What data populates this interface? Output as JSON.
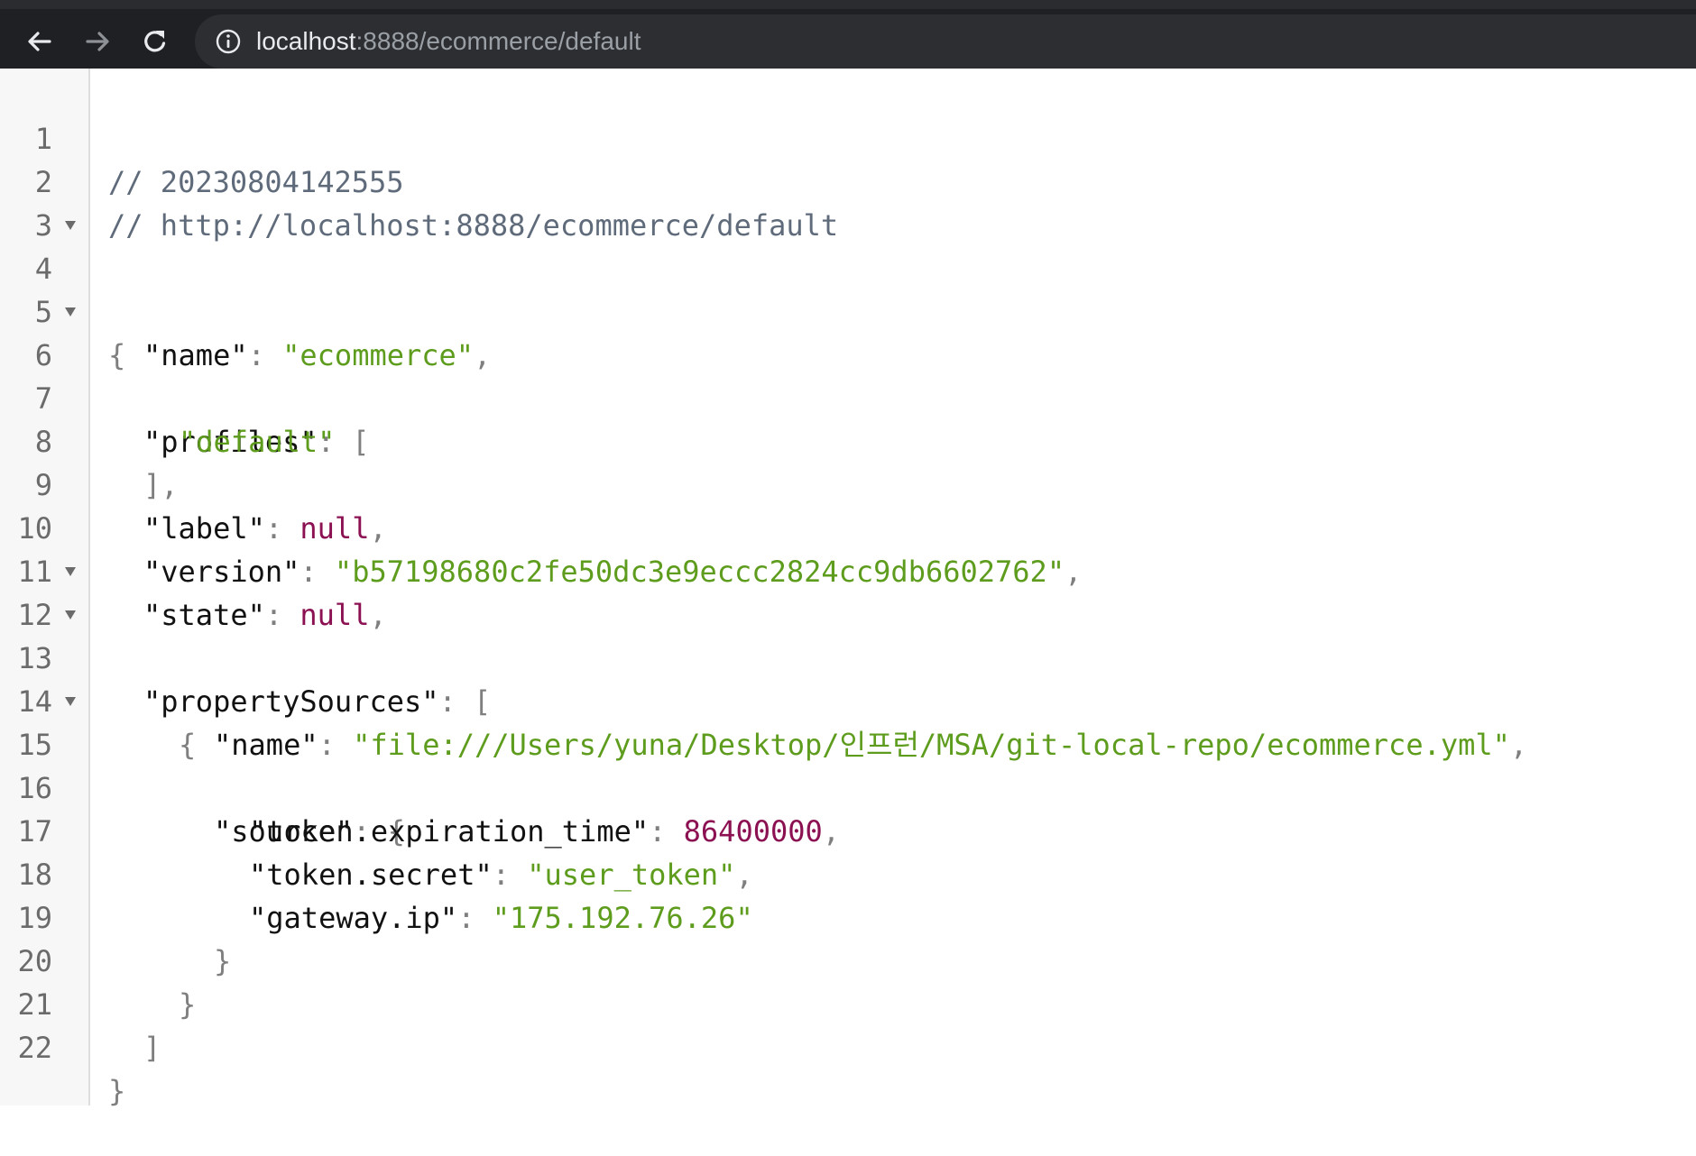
{
  "browser": {
    "url_host": "localhost",
    "url_rest": ":8888/ecommerce/default",
    "back_icon": "back-arrow-icon",
    "forward_icon": "forward-arrow-icon",
    "reload_icon": "reload-icon",
    "info_icon": "info-icon"
  },
  "colors": {
    "toolbar": "#1f2023",
    "address_bar": "#2d2e31",
    "string": "#5e9c1d",
    "null_number": "#8b1152",
    "comment": "#5f6b7a"
  },
  "lines": {
    "l1": {
      "num": "1",
      "comment": "// 20230804142555"
    },
    "l2": {
      "num": "2",
      "comment": "// http://localhost:8888/ecommerce/default"
    },
    "l3": {
      "num": "3"
    },
    "l4": {
      "num": "4",
      "open": "{"
    },
    "l5": {
      "num": "5",
      "key": "\"name\"",
      "colon": ": ",
      "value": "\"ecommerce\"",
      "tail": ","
    },
    "l6": {
      "num": "6",
      "key": "\"profiles\"",
      "colon": ": ",
      "open": "["
    },
    "l7": {
      "num": "7",
      "value": "\"default\""
    },
    "l8": {
      "num": "8",
      "close": "],"
    },
    "l9": {
      "num": "9",
      "key": "\"label\"",
      "colon": ": ",
      "value": "null",
      "tail": ","
    },
    "l10": {
      "num": "10",
      "key": "\"version\"",
      "colon": ": ",
      "value": "\"b57198680c2fe50dc3e9eccc2824cc9db6602762\"",
      "tail": ","
    },
    "l11": {
      "num": "11",
      "key": "\"state\"",
      "colon": ": ",
      "value": "null",
      "tail": ","
    },
    "l12": {
      "num": "12",
      "key": "\"propertySources\"",
      "colon": ": ",
      "open": "["
    },
    "l13": {
      "num": "13",
      "open": "{"
    },
    "l14": {
      "num": "14",
      "key": "\"name\"",
      "colon": ": ",
      "value": "\"file:///Users/yuna/Desktop/인프런/MSA/git-local-repo/ecommerce.yml\"",
      "tail": ","
    },
    "l15": {
      "num": "15",
      "key": "\"source\"",
      "colon": ": ",
      "open": "{"
    },
    "l16": {
      "num": "16",
      "key": "\"token.expiration_time\"",
      "colon": ": ",
      "value": "86400000",
      "tail": ","
    },
    "l17": {
      "num": "17",
      "key": "\"token.secret\"",
      "colon": ": ",
      "value": "\"user_token\"",
      "tail": ","
    },
    "l18": {
      "num": "18",
      "key": "\"gateway.ip\"",
      "colon": ": ",
      "value": "\"175.192.76.26\""
    },
    "l19": {
      "num": "19",
      "close": "}"
    },
    "l20": {
      "num": "20",
      "close": "}"
    },
    "l21": {
      "num": "21",
      "close": "]"
    },
    "l22": {
      "num": "22",
      "close": "}"
    }
  }
}
